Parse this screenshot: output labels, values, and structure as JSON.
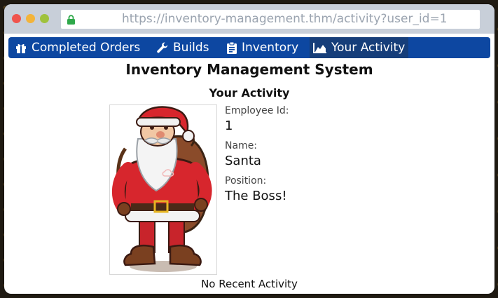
{
  "browser": {
    "url": "https://inventory-management.thm/activity?user_id=1"
  },
  "nav": {
    "items": [
      {
        "label": "Completed Orders",
        "icon": "gift-icon"
      },
      {
        "label": "Builds",
        "icon": "wrench-icon"
      },
      {
        "label": "Inventory",
        "icon": "clipboard-icon"
      },
      {
        "label": "Your Activity",
        "icon": "area-chart-icon",
        "active": true
      }
    ]
  },
  "page": {
    "title": "Inventory Management System",
    "subtitle": "Your Activity"
  },
  "profile": {
    "employee_id_label": "Employee Id:",
    "employee_id": "1",
    "name_label": "Name:",
    "name": "Santa",
    "position_label": "Position:",
    "position": "The Boss!"
  },
  "activity": {
    "empty_message": "No Recent Activity"
  },
  "colors": {
    "navbar": "#0d47a1",
    "active_tab": "#163e7a",
    "titlebar": "#c8cfd9"
  }
}
